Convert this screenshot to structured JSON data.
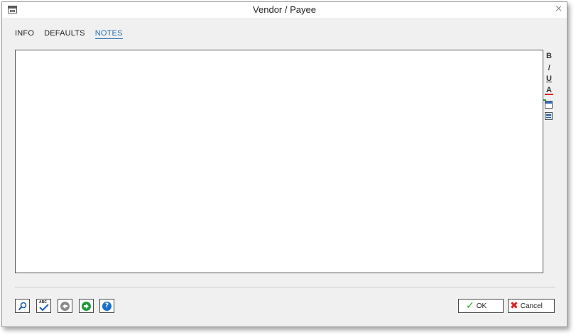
{
  "window": {
    "title": "Vendor / Payee",
    "close_glyph": "×"
  },
  "tabs": [
    {
      "label": "INFO",
      "active": false
    },
    {
      "label": "DEFAULTS",
      "active": false
    },
    {
      "label": "NOTES",
      "active": true
    }
  ],
  "editor": {
    "content": ""
  },
  "format_toolbar": {
    "bold": "B",
    "italic": "I",
    "underline": "U",
    "font_color": "A",
    "font_color_swatch": "#e02020",
    "insert_date_icon": "calendar-icon",
    "insert_text_icon": "text-block-icon"
  },
  "bottom_toolbar": {
    "search_icon": "magnifier-icon",
    "spellcheck_label": "ABC",
    "previous_icon": "left-arrow-circle-icon",
    "next_icon": "right-arrow-circle-icon",
    "help_label": "?",
    "previous_color": "#8a8a8a",
    "next_color": "#1a9a3a",
    "help_color": "#1a6fc8"
  },
  "buttons": {
    "ok_label": "OK",
    "ok_icon": "✓",
    "cancel_label": "Cancel",
    "cancel_icon": "✖"
  }
}
